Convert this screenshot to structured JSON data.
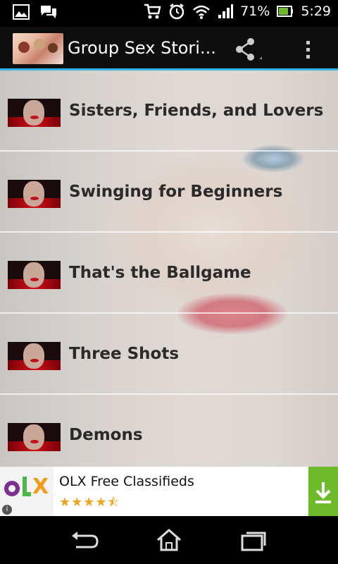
{
  "status_bar": {
    "icons": [
      "image-icon",
      "chat-icon",
      "cart-icon",
      "alarm-icon",
      "wifi-icon",
      "signal-icon",
      "battery-icon"
    ],
    "battery_percent": "71%",
    "time": "5:29"
  },
  "action_bar": {
    "title": "Group Sex Stori...",
    "accent_color": "#33b5e5"
  },
  "stories": [
    {
      "title": "Sisters, Friends, and Lovers"
    },
    {
      "title": "Swinging for Beginners"
    },
    {
      "title": "That's the Ballgame"
    },
    {
      "title": "Three Shots"
    },
    {
      "title": "Demons"
    }
  ],
  "ad": {
    "title": "OLX Free Classifieds",
    "rating_stars": "★★★★⯪",
    "info_label": "i",
    "brand_color": "#6dbb2b"
  }
}
